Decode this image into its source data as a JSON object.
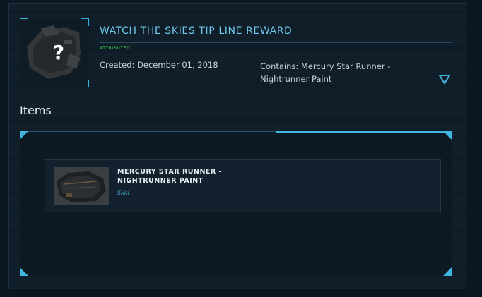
{
  "pledge": {
    "title": "WATCH THE SKIES TIP LINE REWARD",
    "status": "ATTRIBUTED",
    "created": "Created: December 01, 2018",
    "contains": "Contains: Mercury Star Runner - Nightrunner Paint",
    "thumbnail_icon": "question-mark-ship-icon",
    "toggle_icon": "chevron-down-icon"
  },
  "items_section": {
    "heading": "Items",
    "items": [
      {
        "name": "MERCURY STAR RUNNER - NIGHTRUNNER PAINT",
        "type": "Skin",
        "image_icon": "ship-skin-image"
      }
    ]
  },
  "colors": {
    "accent": "#3fb8e0",
    "title": "#6fc8ea",
    "status": "#3ee04a",
    "background": "#0f1d28"
  }
}
